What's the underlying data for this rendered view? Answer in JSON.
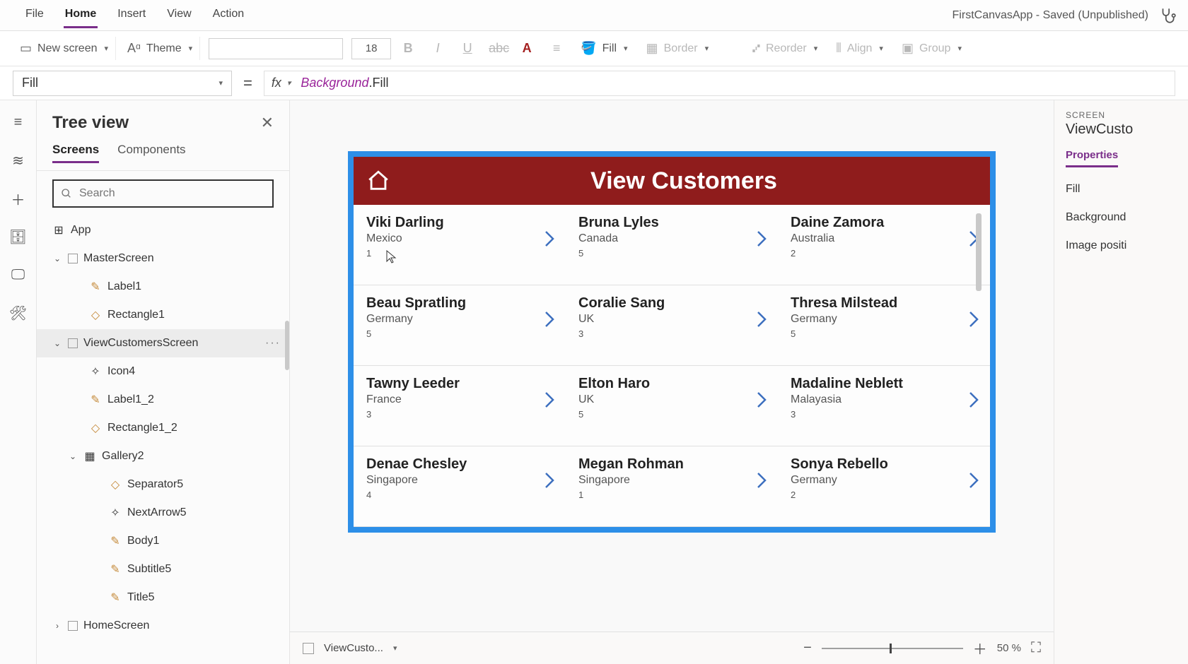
{
  "menubar": {
    "items": [
      "File",
      "Home",
      "Insert",
      "View",
      "Action"
    ],
    "active": "Home",
    "title": "FirstCanvasApp - Saved (Unpublished)"
  },
  "ribbon": {
    "new_screen": "New screen",
    "theme": "Theme",
    "font_size": "18",
    "fill": "Fill",
    "border": "Border",
    "reorder": "Reorder",
    "align": "Align",
    "group": "Group"
  },
  "formula": {
    "property": "Fill",
    "fx": "fx",
    "expr_obj": "Background",
    "expr_suffix": ".Fill"
  },
  "tree": {
    "title": "Tree view",
    "tabs": [
      "Screens",
      "Components"
    ],
    "active_tab": "Screens",
    "search_placeholder": "Search",
    "items": {
      "app": "App",
      "master": "MasterScreen",
      "label1": "Label1",
      "rect1": "Rectangle1",
      "viewcust": "ViewCustomersScreen",
      "icon4": "Icon4",
      "label12": "Label1_2",
      "rect12": "Rectangle1_2",
      "gallery2": "Gallery2",
      "sep5": "Separator5",
      "next5": "NextArrow5",
      "body1": "Body1",
      "subtitle5": "Subtitle5",
      "title5": "Title5",
      "home": "HomeScreen"
    }
  },
  "screen": {
    "title": "View Customers",
    "customers": [
      {
        "name": "Viki Darling",
        "country": "Mexico",
        "num": "1"
      },
      {
        "name": "Bruna Lyles",
        "country": "Canada",
        "num": "5"
      },
      {
        "name": "Daine Zamora",
        "country": "Australia",
        "num": "2"
      },
      {
        "name": "Beau Spratling",
        "country": "Germany",
        "num": "5"
      },
      {
        "name": "Coralie Sang",
        "country": "UK",
        "num": "3"
      },
      {
        "name": "Thresa Milstead",
        "country": "Germany",
        "num": "5"
      },
      {
        "name": "Tawny Leeder",
        "country": "France",
        "num": "3"
      },
      {
        "name": "Elton Haro",
        "country": "UK",
        "num": "5"
      },
      {
        "name": "Madaline Neblett",
        "country": "Malayasia",
        "num": "3"
      },
      {
        "name": "Denae Chesley",
        "country": "Singapore",
        "num": "4"
      },
      {
        "name": "Megan Rohman",
        "country": "Singapore",
        "num": "1"
      },
      {
        "name": "Sonya Rebello",
        "country": "Germany",
        "num": "2"
      }
    ]
  },
  "statusbar": {
    "selected": "ViewCusto...",
    "zoom": "50",
    "zoom_unit": "%"
  },
  "props": {
    "category": "SCREEN",
    "name": "ViewCusto",
    "tab": "Properties",
    "items": [
      "Fill",
      "Background",
      "Image positi"
    ]
  }
}
